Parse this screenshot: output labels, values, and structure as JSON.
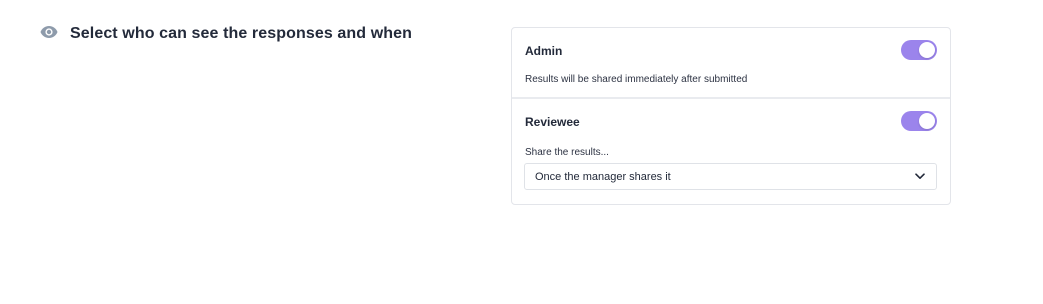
{
  "section": {
    "title": "Select who can see the responses and when",
    "icon": "eye-icon"
  },
  "colors": {
    "accent": "#9b84ec",
    "icon_muted": "#8e9bab",
    "text_primary": "#232a3a",
    "border": "#e3e5ea"
  },
  "visibility": {
    "admin": {
      "label": "Admin",
      "enabled": true,
      "description": "Results will be shared immediately after submitted"
    },
    "reviewee": {
      "label": "Reviewee",
      "enabled": true,
      "share_label": "Share the results...",
      "share_select": {
        "value": "Once the manager shares it",
        "icon": "chevron-down-icon"
      }
    }
  }
}
